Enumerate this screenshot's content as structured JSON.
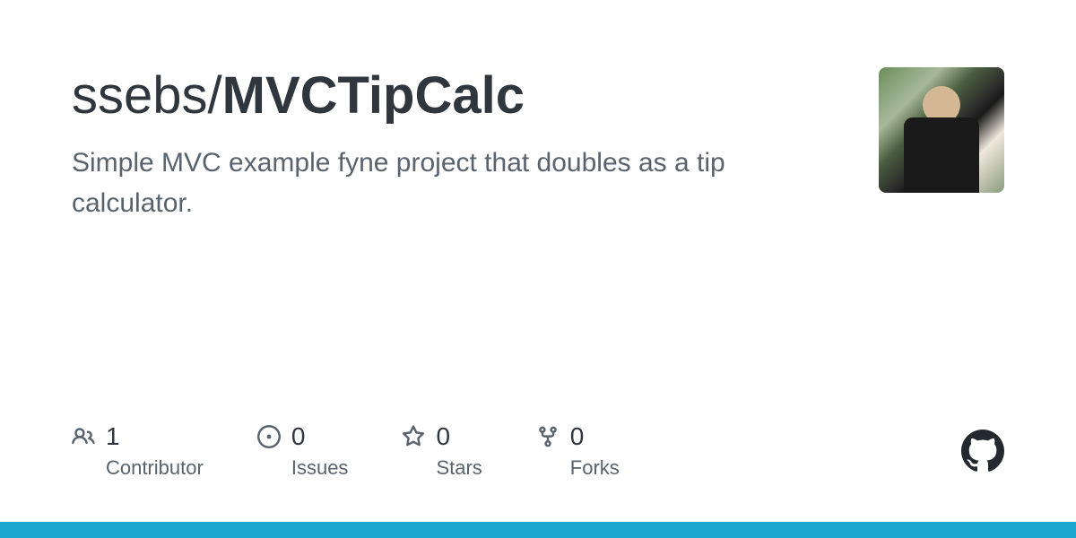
{
  "repo": {
    "owner": "ssebs",
    "separator": "/",
    "name": "MVCTipCalc"
  },
  "description": "Simple MVC example fyne project that doubles as a tip calculator.",
  "stats": {
    "contributors": {
      "count": "1",
      "label": "Contributor"
    },
    "issues": {
      "count": "0",
      "label": "Issues"
    },
    "stars": {
      "count": "0",
      "label": "Stars"
    },
    "forks": {
      "count": "0",
      "label": "Forks"
    }
  }
}
